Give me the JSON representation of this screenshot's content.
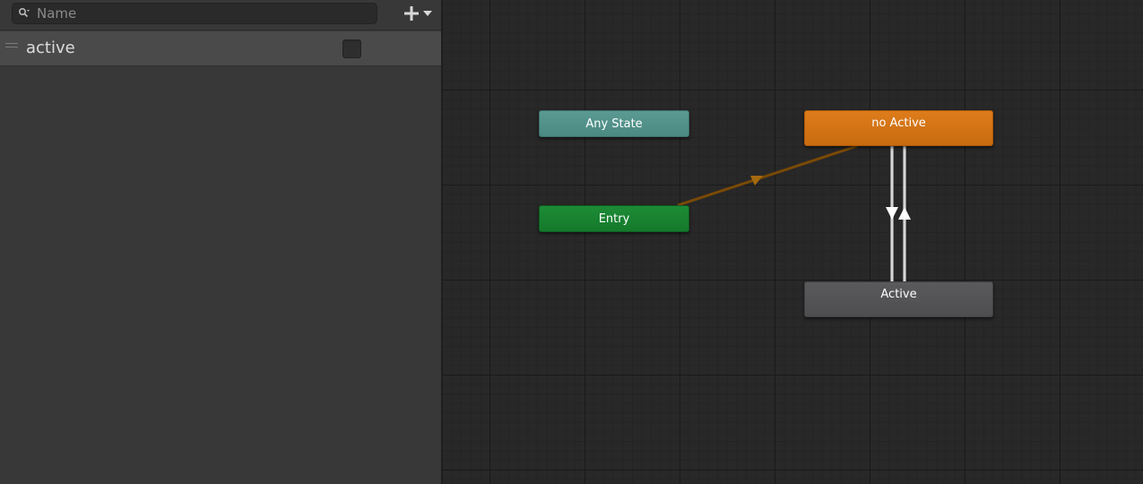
{
  "parameters_panel": {
    "search": {
      "placeholder": "Name",
      "value": ""
    },
    "add_button_icon": "plus-icon",
    "dropdown_icon": "triangle-down-icon",
    "parameters": [
      {
        "name": "active",
        "type": "bool",
        "checked": false
      }
    ]
  },
  "graph": {
    "states": {
      "any_state": {
        "label": "Any State",
        "color": "#4f8f87"
      },
      "entry": {
        "label": "Entry",
        "color": "#198432"
      },
      "no_active": {
        "label": "no Active",
        "color": "#d27414"
      },
      "active": {
        "label": "Active",
        "color": "#545456"
      }
    },
    "transitions": [
      {
        "from": "Entry",
        "to": "no Active",
        "color": "#7a4a06"
      },
      {
        "from": "no Active",
        "to": "Active",
        "color": "#d0d0d0"
      },
      {
        "from": "Active",
        "to": "no Active",
        "color": "#d0d0d0"
      }
    ]
  }
}
